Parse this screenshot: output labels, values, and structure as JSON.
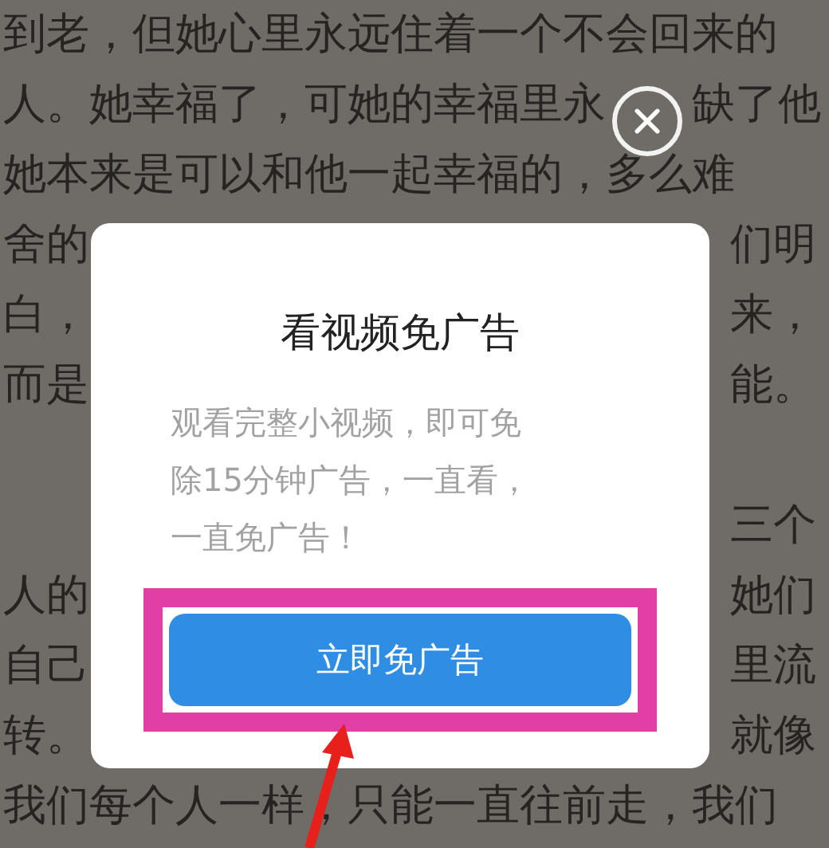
{
  "page_text": [
    {
      "kind": "full",
      "text": "到老，但她心里永远住着一个不会回来的"
    },
    {
      "kind": "close",
      "left": "人。她幸福了，可她的幸福里永",
      "right": "缺了他"
    },
    {
      "kind": "full",
      "text": "她本来是可以和他一起幸福的，多么难"
    },
    {
      "kind": "split",
      "left": "舍的",
      "right": "们明"
    },
    {
      "kind": "split",
      "left": "白，",
      "right": "来，"
    },
    {
      "kind": "split",
      "left": "而是",
      "right": "能。"
    },
    {
      "kind": "blank"
    },
    {
      "kind": "split",
      "right": "三个"
    },
    {
      "kind": "split",
      "left": "人的",
      "right": "她们"
    },
    {
      "kind": "split",
      "left": "自己",
      "right": "里流"
    },
    {
      "kind": "split",
      "left": "转。",
      "right": "就像"
    },
    {
      "kind": "full",
      "text": "我们每个人一样，只能一直往前走，我们"
    }
  ],
  "dialog": {
    "title": "看视频免广告",
    "body": "观看完整小视频，即可免除15分钟广告，一直看，一直免广告！",
    "button": "立即免广告",
    "highlighted": true,
    "arrow": true
  }
}
